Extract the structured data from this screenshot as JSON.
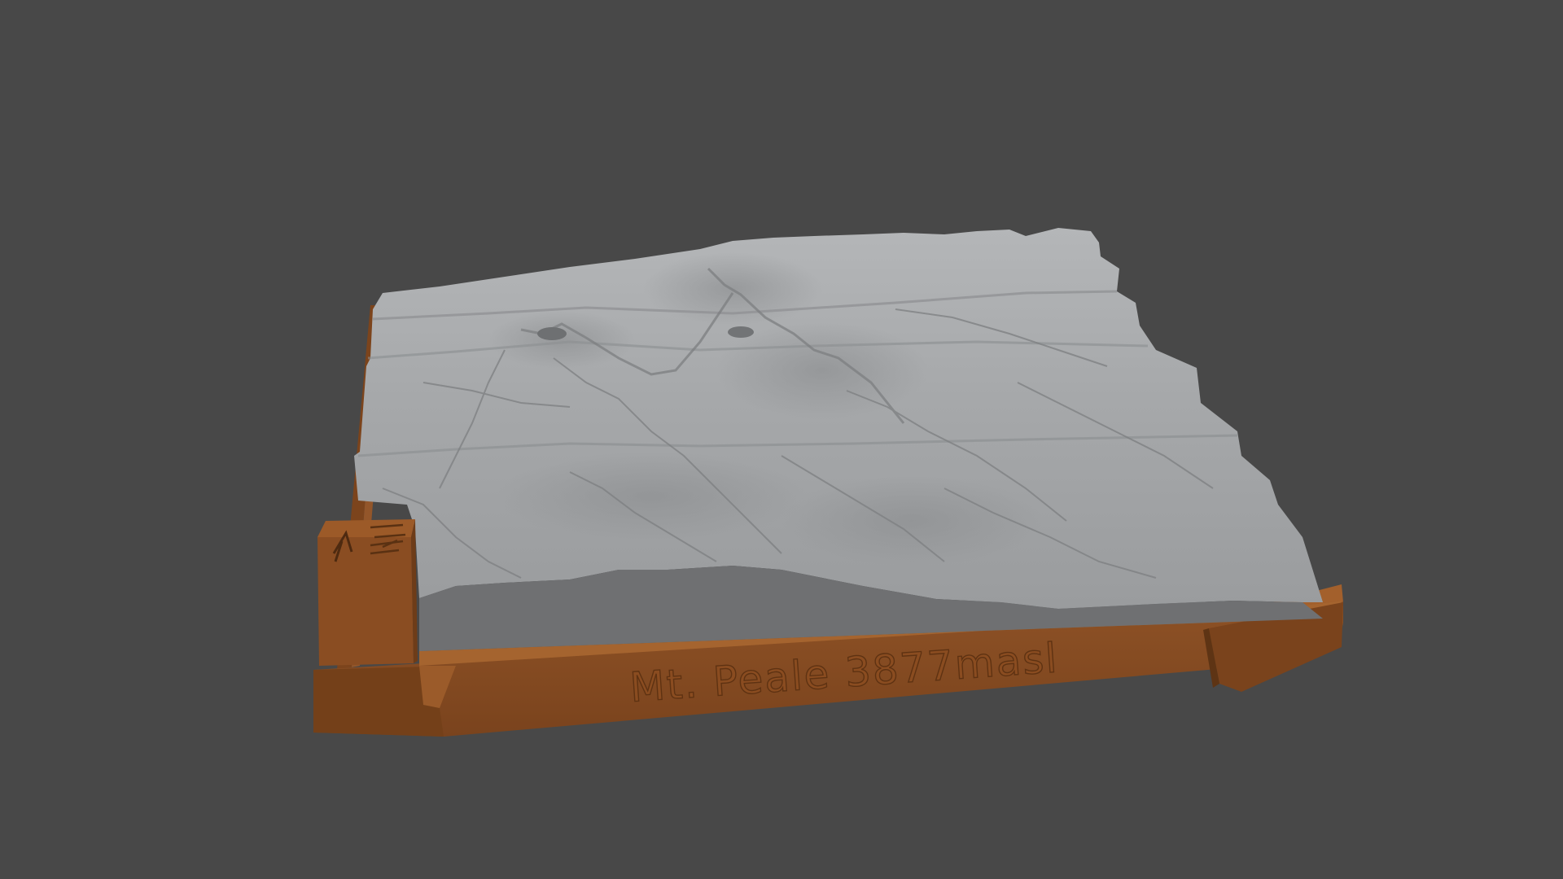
{
  "scene": {
    "subject": "terrain-relief-model",
    "background_color": "#484848",
    "base_color": "#8a4f24",
    "terrain_color": "#a3a6a9"
  },
  "plaque": {
    "engraved_text": "Mt. Peale 3877masl"
  }
}
